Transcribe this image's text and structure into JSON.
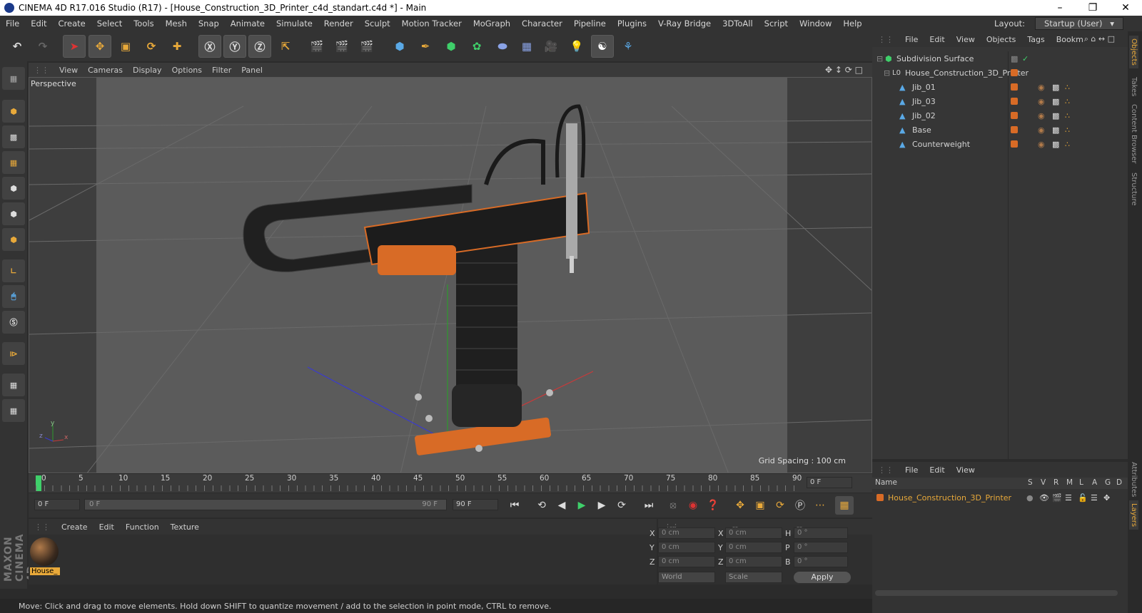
{
  "window": {
    "title": "CINEMA 4D R17.016 Studio (R17) - [House_Construction_3D_Printer_c4d_standart.c4d *] - Main"
  },
  "menu": [
    "File",
    "Edit",
    "Create",
    "Select",
    "Tools",
    "Mesh",
    "Snap",
    "Animate",
    "Simulate",
    "Render",
    "Sculpt",
    "Motion Tracker",
    "MoGraph",
    "Character",
    "Pipeline",
    "Plugins",
    "V-Ray Bridge",
    "3DToAll",
    "Script",
    "Window",
    "Help"
  ],
  "layout": {
    "label": "Layout:",
    "value": "Startup (User)"
  },
  "viewport": {
    "menu": [
      "View",
      "Cameras",
      "Display",
      "Options",
      "Filter",
      "Panel"
    ],
    "view_name": "Perspective",
    "grid_spacing": "Grid Spacing : 100 cm",
    "axes": {
      "x": "x",
      "y": "y",
      "z": "z"
    }
  },
  "timeline": {
    "ticks": [
      "0",
      "5",
      "10",
      "15",
      "20",
      "25",
      "30",
      "35",
      "40",
      "45",
      "50",
      "55",
      "60",
      "65",
      "70",
      "75",
      "80",
      "85",
      "90"
    ],
    "current_frame": "0 F",
    "start_frame": "0 F",
    "range_start": "0 F",
    "range_end": "90 F",
    "end_frame": "90 F"
  },
  "materials": {
    "menu": [
      "Create",
      "Edit",
      "Function",
      "Texture"
    ],
    "items": [
      {
        "label": "House_"
      }
    ]
  },
  "coords": {
    "headers": [
      "--",
      "--",
      "--"
    ],
    "rows": [
      {
        "a": "X",
        "av": "0 cm",
        "b": "X",
        "bv": "0 cm",
        "c": "H",
        "cv": "0 °"
      },
      {
        "a": "Y",
        "av": "0 cm",
        "b": "Y",
        "bv": "0 cm",
        "c": "P",
        "cv": "0 °"
      },
      {
        "a": "Z",
        "av": "0 cm",
        "b": "Z",
        "bv": "0 cm",
        "c": "B",
        "cv": "0 °"
      }
    ],
    "mode": "World",
    "scale": "Scale",
    "apply": "Apply"
  },
  "objects": {
    "menu": [
      "File",
      "Edit",
      "View",
      "Objects",
      "Tags",
      "Bookm"
    ],
    "rows": [
      {
        "name": "Subdivision Surface",
        "level": 0
      },
      {
        "name": "House_Construction_3D_Printer",
        "level": 1
      },
      {
        "name": "Jib_01",
        "level": 2
      },
      {
        "name": "Jib_03",
        "level": 2
      },
      {
        "name": "Jib_02",
        "level": 2
      },
      {
        "name": "Base",
        "level": 2
      },
      {
        "name": "Counterweight",
        "level": 2
      }
    ]
  },
  "layers": {
    "menu": [
      "File",
      "Edit",
      "View"
    ],
    "columns": [
      "Name",
      "S",
      "V",
      "R",
      "M",
      "L",
      "A",
      "G",
      "D"
    ],
    "rows": [
      {
        "name": "House_Construction_3D_Printer"
      }
    ]
  },
  "right_tabs": [
    "Objects",
    "Takes",
    "Content Browser",
    "Structure",
    "Attributes",
    "Layers"
  ],
  "brand": "MAXON CINEMA 4D",
  "status": "Move: Click and drag to move elements. Hold down SHIFT to quantize movement / add to the selection in point mode, CTRL to remove.",
  "colors": {
    "accent": "#d86b26",
    "bg": "#333333",
    "viewport": "#4a4a4a",
    "highlight": "#e8a93a"
  }
}
